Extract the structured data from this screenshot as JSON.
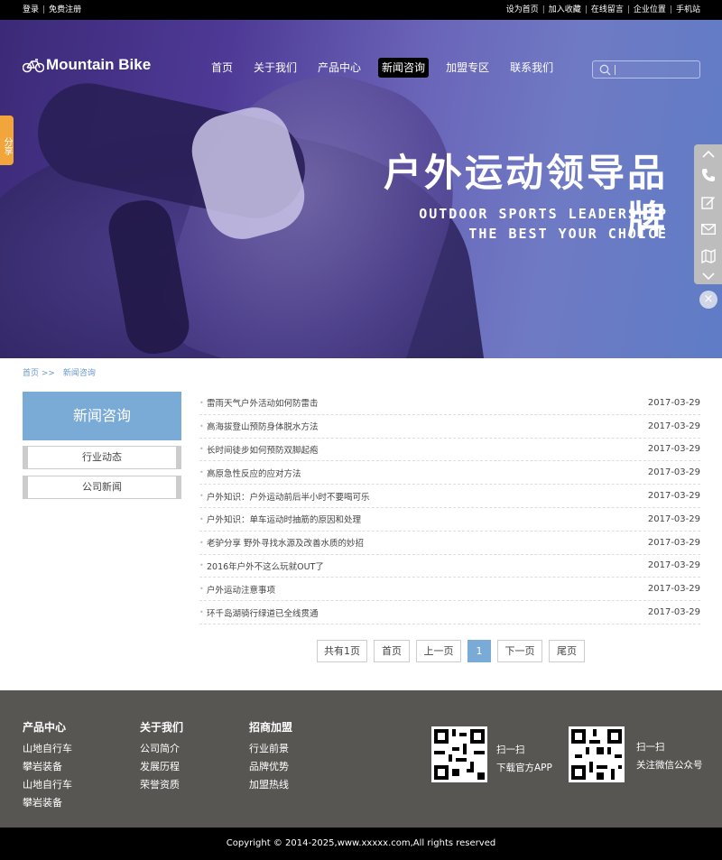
{
  "topbar": {
    "login": "登录",
    "register": "免费注册",
    "links": [
      "设为首页",
      "加入收藏",
      "在线留言",
      "企业位置",
      "手机站"
    ]
  },
  "brand": {
    "logo_text": "Mountain Bike"
  },
  "nav": {
    "items": [
      "首页",
      "关于我们",
      "产品中心",
      "新闻咨询",
      "加盟专区",
      "联系我们"
    ],
    "active_index": 3
  },
  "search": {
    "placeholder": ""
  },
  "banner": {
    "headline": "户外运动领导品牌",
    "sub1": "OUTDOOR SPORTS LEADERSHIP",
    "sub2": "THE BEST YOUR CHOICE"
  },
  "share_tab": "分享",
  "side_tools": {
    "icons": [
      "chevron-up-icon",
      "phone-icon",
      "edit-icon",
      "mail-icon",
      "map-icon",
      "chevron-down-icon"
    ],
    "close": "×"
  },
  "breadcrumb": {
    "home": "首页",
    "sep": ">>",
    "current": "新闻咨询"
  },
  "left_menu": {
    "title": "新闻咨询",
    "items": [
      "行业动态",
      "公司新闻"
    ]
  },
  "news": [
    {
      "title": "雷雨天气户外活动如何防雷击",
      "date": "2017-03-29"
    },
    {
      "title": "高海拔登山预防身体脱水方法",
      "date": "2017-03-29"
    },
    {
      "title": "长时间徒步如何预防双脚起疱",
      "date": "2017-03-29"
    },
    {
      "title": "高原急性反应的应对方法",
      "date": "2017-03-29"
    },
    {
      "title": "户外知识：户外运动前后半小时不要喝可乐",
      "date": "2017-03-29"
    },
    {
      "title": "户外知识：单车运动时抽筋的原因和处理",
      "date": "2017-03-29"
    },
    {
      "title": "老驴分享 野外寻找水源及改善水质的妙招",
      "date": "2017-03-29"
    },
    {
      "title": "2016年户外不这么玩就OUT了",
      "date": "2017-03-29"
    },
    {
      "title": "户外运动注意事项",
      "date": "2017-03-29"
    },
    {
      "title": "环千岛湖骑行绿道已全线贯通",
      "date": "2017-03-29"
    }
  ],
  "pager": {
    "total": "共有1页",
    "first": "首页",
    "prev": "上一页",
    "current": "1",
    "next": "下一页",
    "last": "尾页"
  },
  "footer": {
    "cols": [
      {
        "title": "产品中心",
        "links": [
          "山地自行车",
          "攀岩装备",
          "山地自行车",
          "攀岩装备"
        ]
      },
      {
        "title": "关于我们",
        "links": [
          "公司简介",
          "发展历程",
          "荣誉资质"
        ]
      },
      {
        "title": "招商加盟",
        "links": [
          "行业前景",
          "品牌优势",
          "加盟热线"
        ]
      }
    ],
    "qr1": {
      "line1": "扫一扫",
      "line2": "下载官方APP"
    },
    "qr2": {
      "line1": "扫一扫",
      "line2": "关注微信公众号"
    },
    "copyright": "Copyright © 2014-2025,www.xxxxx.com,All rights reserved"
  },
  "colors": {
    "accent": "#7aaad6",
    "footer_bg": "#585653",
    "share_tab": "#f2a53b"
  }
}
